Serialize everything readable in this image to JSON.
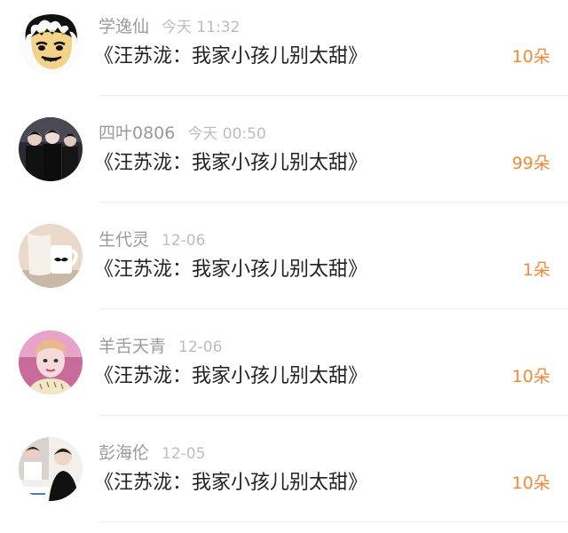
{
  "items": [
    {
      "user": "学逸仙",
      "time": "今天 11:32",
      "title": "《汪苏泷：我家小孩儿别太甜》",
      "amount": "10朵",
      "avatar_icon": "cartoon-boy-avatar-icon"
    },
    {
      "user": "四叶0806",
      "time": "今天 00:50",
      "title": "《汪苏泷：我家小孩儿别太甜》",
      "amount": "99朵",
      "avatar_icon": "group-photo-avatar-icon"
    },
    {
      "user": "生代灵",
      "time": "12-06",
      "title": "《汪苏泷：我家小孩儿别太甜》",
      "amount": "1朵",
      "avatar_icon": "mug-mustache-avatar-icon"
    },
    {
      "user": "羊舌天青",
      "time": "12-06",
      "title": "《汪苏泷：我家小孩儿别太甜》",
      "amount": "10朵",
      "avatar_icon": "portrait-avatar-icon"
    },
    {
      "user": "彭海伦",
      "time": "12-05",
      "title": "《汪苏泷：我家小孩儿别太甜》",
      "amount": "10朵",
      "avatar_icon": "photo-collage-avatar-icon"
    }
  ],
  "colors": {
    "amount": "#ee8a3b",
    "username": "#9a9a9a",
    "time": "#bdbdbd",
    "title": "#222222"
  }
}
